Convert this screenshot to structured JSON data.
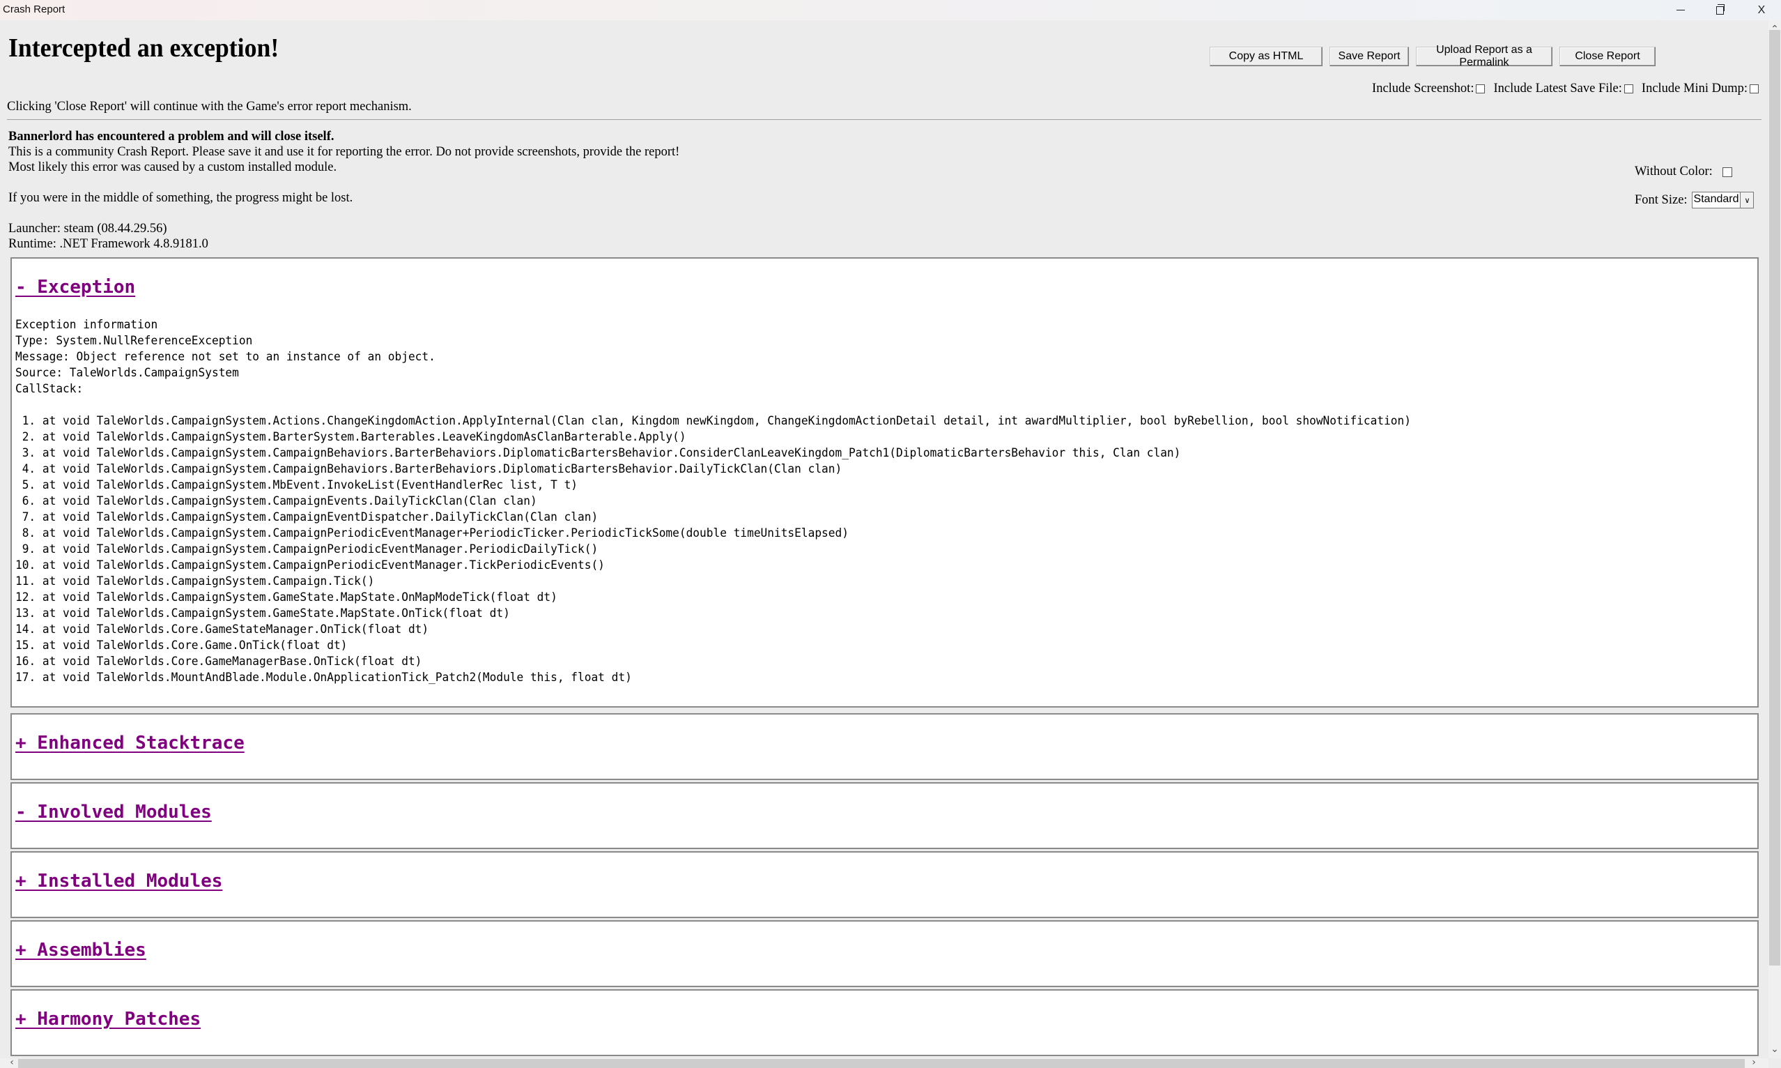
{
  "window": {
    "title": "Crash Report",
    "controls": {
      "minimize": "—",
      "restore": "restore",
      "close": "X"
    }
  },
  "header": {
    "heading": "Intercepted an exception!",
    "close_note": "Clicking 'Close Report' will continue with the Game's error report mechanism."
  },
  "toolbar": {
    "copy_html": "Copy as HTML",
    "save_report": "Save Report",
    "upload_permalink": "Upload Report as a Permalink",
    "close_report": "Close Report"
  },
  "options": {
    "include_screenshot": {
      "label": "Include Screenshot:",
      "checked": false
    },
    "include_save": {
      "label": "Include Latest Save File:",
      "checked": false
    },
    "include_dump": {
      "label": "Include Mini Dump:",
      "checked": false
    },
    "without_color": {
      "label": "Without Color:",
      "checked": false
    },
    "font_size": {
      "label": "Font Size:",
      "selected": "Standard"
    }
  },
  "intro": {
    "bold_line": "Bannerlord has encountered a problem and will close itself.",
    "line2": "This is a community Crash Report. Please save it and use it for reporting the error. Do not provide screenshots, provide the report!",
    "line3": "Most likely this error was caused by a custom installed module.",
    "line4": "If you were in the middle of something, the progress might be lost."
  },
  "meta": {
    "launcher": "Launcher: steam (08.44.29.56)",
    "runtime": "Runtime: .NET Framework 4.8.9181.0"
  },
  "exception": {
    "toggle": "- Exception",
    "info_header": "Exception information",
    "type": "Type: System.NullReferenceException",
    "message": "Message: Object reference not set to an instance of an object.",
    "source": "Source: TaleWorlds.CampaignSystem",
    "callstack_label": "CallStack:",
    "callstack": [
      "at void TaleWorlds.CampaignSystem.Actions.ChangeKingdomAction.ApplyInternal(Clan clan, Kingdom newKingdom, ChangeKingdomActionDetail detail, int awardMultiplier, bool byRebellion, bool showNotification)",
      "at void TaleWorlds.CampaignSystem.BarterSystem.Barterables.LeaveKingdomAsClanBarterable.Apply()",
      "at void TaleWorlds.CampaignSystem.CampaignBehaviors.BarterBehaviors.DiplomaticBartersBehavior.ConsiderClanLeaveKingdom_Patch1(DiplomaticBartersBehavior this, Clan clan)",
      "at void TaleWorlds.CampaignSystem.CampaignBehaviors.BarterBehaviors.DiplomaticBartersBehavior.DailyTickClan(Clan clan)",
      "at void TaleWorlds.CampaignSystem.MbEvent.InvokeList(EventHandlerRec list, T t)",
      "at void TaleWorlds.CampaignSystem.CampaignEvents.DailyTickClan(Clan clan)",
      "at void TaleWorlds.CampaignSystem.CampaignEventDispatcher.DailyTickClan(Clan clan)",
      "at void TaleWorlds.CampaignSystem.CampaignPeriodicEventManager+PeriodicTicker.PeriodicTickSome(double timeUnitsElapsed)",
      "at void TaleWorlds.CampaignSystem.CampaignPeriodicEventManager.PeriodicDailyTick()",
      "at void TaleWorlds.CampaignSystem.CampaignPeriodicEventManager.TickPeriodicEvents()",
      "at void TaleWorlds.CampaignSystem.Campaign.Tick()",
      "at void TaleWorlds.CampaignSystem.GameState.MapState.OnMapModeTick(float dt)",
      "at void TaleWorlds.CampaignSystem.GameState.MapState.OnTick(float dt)",
      "at void TaleWorlds.Core.GameStateManager.OnTick(float dt)",
      "at void TaleWorlds.Core.Game.OnTick(float dt)",
      "at void TaleWorlds.Core.GameManagerBase.OnTick(float dt)",
      "at void TaleWorlds.MountAndBlade.Module.OnApplicationTick_Patch2(Module this, float dt)"
    ]
  },
  "sections": [
    {
      "toggle": "+ Enhanced Stacktrace",
      "expanded": false
    },
    {
      "toggle": "- Involved Modules",
      "expanded": true
    },
    {
      "toggle": "+ Installed Modules",
      "expanded": false
    },
    {
      "toggle": "+ Assemblies",
      "expanded": false
    },
    {
      "toggle": "+ Harmony Patches",
      "expanded": false
    }
  ],
  "colors": {
    "link": "#800080",
    "page_bg": "#ececec",
    "panel_bg": "#ffffff",
    "panel_border": "#8a8a8a"
  },
  "scrollbars": {
    "vertical_icons": {
      "up": "chevron-up",
      "down": "chevron-down"
    },
    "horizontal_icons": {
      "left": "chevron-left",
      "right": "chevron-right"
    }
  }
}
